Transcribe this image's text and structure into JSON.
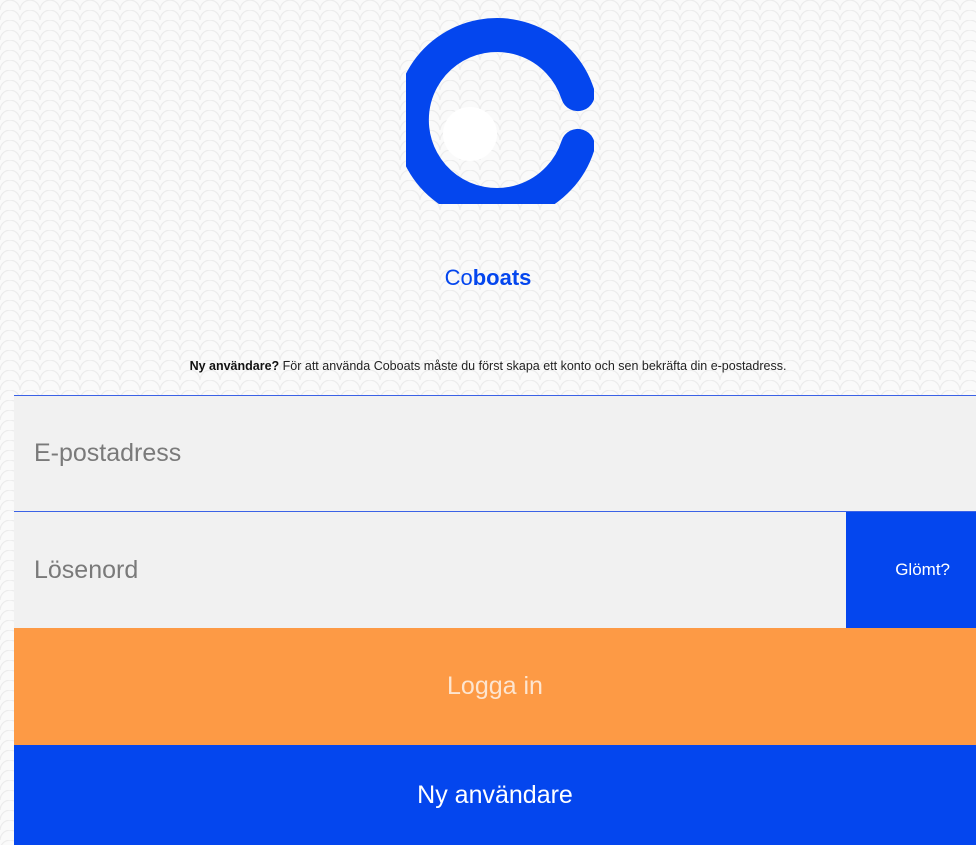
{
  "brand": {
    "name_light": "Co",
    "name_bold": "boats"
  },
  "notice": {
    "lead": "Ny användare?",
    "text": " För att använda Coboats måste du först skapa ett konto och sen bekräfta din e-postadress."
  },
  "form": {
    "email_placeholder": "E-postadress",
    "password_placeholder": "Lösenord",
    "forgot_label": "Glömt?"
  },
  "buttons": {
    "login_label": "Logga in",
    "signup_label": "Ny användare"
  },
  "colors": {
    "brand_blue": "#0446ee",
    "login_orange": "#fd9a45",
    "field_bg": "#f1f1f1"
  }
}
